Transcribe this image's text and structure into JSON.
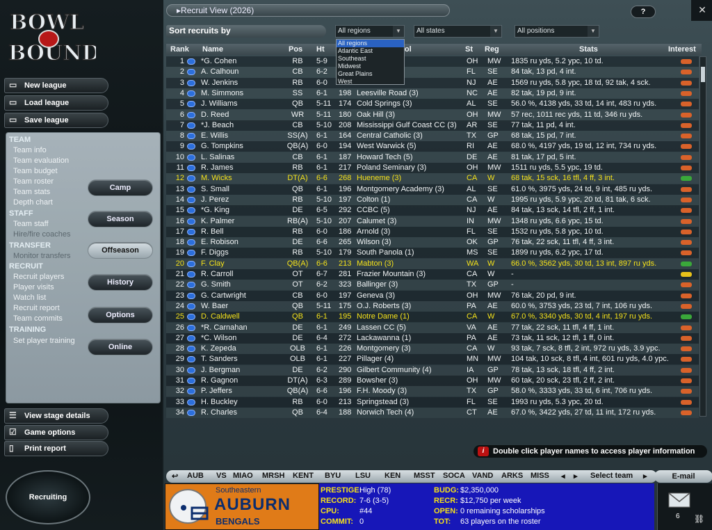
{
  "logo": {
    "line1": "BOWL",
    "line2": "BOUND"
  },
  "left": {
    "buttons": [
      {
        "label": "New league",
        "icon": "folder-icon"
      },
      {
        "label": "Load league",
        "icon": "folder-open-icon"
      },
      {
        "label": "Save league",
        "icon": "folder-save-icon"
      }
    ],
    "menu": {
      "team_h": "TEAM",
      "team": [
        "Team info",
        "Team evaluation",
        "Team budget",
        "Team roster",
        "Team stats",
        "Depth chart"
      ],
      "staff_h": "STAFF",
      "staff": [
        "Team staff",
        "Hire/fire coaches"
      ],
      "transfer_h": "TRANSFER",
      "transfer": [
        "Monitor transfers"
      ],
      "recruit_h": "RECRUIT",
      "recruit": [
        "Recruit players",
        "Player visits",
        "Watch list",
        "Recruit report",
        "Team commits"
      ],
      "training_h": "TRAINING",
      "training": [
        "Set player training"
      ]
    },
    "stages": [
      "Camp",
      "Season",
      "Offseason",
      "History",
      "Options",
      "Online"
    ],
    "bottom": [
      {
        "label": "View stage details",
        "icon": "list-icon"
      },
      {
        "label": "Game options",
        "icon": "checkbox-icon"
      },
      {
        "label": "Print report",
        "icon": "page-icon"
      }
    ],
    "recruiting": "Recruiting"
  },
  "main": {
    "title": "Recruit View (2026)",
    "help": "?",
    "sort_label": "Sort recruits by",
    "regions": {
      "value": "All regions",
      "options": [
        "All regions",
        "Atlantic East",
        "Southeast",
        "Midwest",
        "Great Plains",
        "West"
      ]
    },
    "states": "All states",
    "positions": "All positions",
    "headers": [
      "Rank",
      "Name",
      "Pos",
      "Ht",
      "Wt",
      "School",
      "St",
      "Reg",
      "Stats",
      "Interest"
    ],
    "info": "Double click player names to access player information",
    "email": "E-mail",
    "select_team": "Select team"
  },
  "players": [
    {
      "rank": "1",
      "name": "*G. Cohen",
      "pos": "RB",
      "ht": "5-9",
      "wt": "",
      "school": "ge (5)",
      "st": "OH",
      "reg": "MW",
      "stats": "1835 ru yds, 5.2 ypc, 10 td.",
      "interest": "#d9622a",
      "gold": false
    },
    {
      "rank": "2",
      "name": "A. Calhoun",
      "pos": "CB",
      "ht": "6-2",
      "wt": "",
      "school": "",
      "st": "FL",
      "reg": "SE",
      "stats": "84 tak, 13 pd, 4 int.",
      "interest": "#d9622a",
      "gold": false
    },
    {
      "rank": "3",
      "name": "W. Jenkins",
      "pos": "RB",
      "ht": "6-0",
      "wt": "",
      "school": "",
      "st": "NJ",
      "reg": "AE",
      "stats": "1569 ru yds, 5.8 ypc, 18 td, 92 tak, 4 sck.",
      "interest": "#d9622a",
      "gold": false
    },
    {
      "rank": "4",
      "name": "M. Simmons",
      "pos": "SS",
      "ht": "6-1",
      "wt": "198",
      "school": "Leesville Road (3)",
      "st": "NC",
      "reg": "AE",
      "stats": "82 tak, 19 pd, 9 int.",
      "interest": "#d9622a",
      "gold": false
    },
    {
      "rank": "5",
      "name": "J. Williams",
      "pos": "QB",
      "ht": "5-11",
      "wt": "174",
      "school": "Cold Springs (3)",
      "st": "AL",
      "reg": "SE",
      "stats": "56.0 %, 4138 yds, 33 td, 14 int, 483 ru yds.",
      "interest": "#d9622a",
      "gold": false
    },
    {
      "rank": "6",
      "name": "D. Reed",
      "pos": "WR",
      "ht": "5-11",
      "wt": "180",
      "school": "Oak Hill (3)",
      "st": "OH",
      "reg": "MW",
      "stats": "57 rec, 1011 rec yds, 11 td, 346 ru yds.",
      "interest": "#d9622a",
      "gold": false
    },
    {
      "rank": "7",
      "name": "*J. Beach",
      "pos": "CB",
      "ht": "5-10",
      "wt": "208",
      "school": "Mississippi Gulf Coast CC (3)",
      "st": "AR",
      "reg": "SE",
      "stats": "77 tak, 11 pd, 4 int.",
      "interest": "#d9622a",
      "gold": false
    },
    {
      "rank": "8",
      "name": "E. Willis",
      "pos": "SS(A)",
      "ht": "6-1",
      "wt": "164",
      "school": "Central Catholic (3)",
      "st": "TX",
      "reg": "GP",
      "stats": "68 tak, 15 pd, 7 int.",
      "interest": "#d9622a",
      "gold": false
    },
    {
      "rank": "9",
      "name": "G. Tompkins",
      "pos": "QB(A)",
      "ht": "6-0",
      "wt": "194",
      "school": "West Warwick (5)",
      "st": "RI",
      "reg": "AE",
      "stats": "68.0 %, 4197 yds, 19 td, 12 int, 734 ru yds.",
      "interest": "#d9622a",
      "gold": false
    },
    {
      "rank": "10",
      "name": "L. Salinas",
      "pos": "CB",
      "ht": "6-1",
      "wt": "187",
      "school": "Howard Tech (5)",
      "st": "DE",
      "reg": "AE",
      "stats": "81 tak, 17 pd, 5 int.",
      "interest": "#d9622a",
      "gold": false
    },
    {
      "rank": "11",
      "name": "R. James",
      "pos": "RB",
      "ht": "6-1",
      "wt": "217",
      "school": "Poland Seminary (3)",
      "st": "OH",
      "reg": "MW",
      "stats": "1511 ru yds, 5.5 ypc, 19 td.",
      "interest": "#d9622a",
      "gold": false
    },
    {
      "rank": "12",
      "name": "M. Wicks",
      "pos": "DT(A)",
      "ht": "6-6",
      "wt": "268",
      "school": "Hueneme (3)",
      "st": "CA",
      "reg": "W",
      "stats": "68 tak, 15 sck, 16 tfl, 4 ff, 3 int.",
      "interest": "#3aa83a",
      "gold": true
    },
    {
      "rank": "13",
      "name": "S. Small",
      "pos": "QB",
      "ht": "6-1",
      "wt": "196",
      "school": "Montgomery Academy (3)",
      "st": "AL",
      "reg": "SE",
      "stats": "61.0 %, 3975 yds, 24 td, 9 int, 485 ru yds.",
      "interest": "#d9622a",
      "gold": false
    },
    {
      "rank": "14",
      "name": "J. Perez",
      "pos": "RB",
      "ht": "5-10",
      "wt": "197",
      "school": "Colton (1)",
      "st": "CA",
      "reg": "W",
      "stats": "1995 ru yds, 5.9 ypc, 20 td, 81 tak, 6 sck.",
      "interest": "#d9622a",
      "gold": false
    },
    {
      "rank": "15",
      "name": "*G. King",
      "pos": "DE",
      "ht": "6-5",
      "wt": "292",
      "school": "CCBC (5)",
      "st": "NJ",
      "reg": "AE",
      "stats": "84 tak, 13 sck, 14 tfl, 2 ff, 1 int.",
      "interest": "#d9622a",
      "gold": false
    },
    {
      "rank": "16",
      "name": "K. Palmer",
      "pos": "RB(A)",
      "ht": "5-10",
      "wt": "207",
      "school": "Calumet (3)",
      "st": "IN",
      "reg": "MW",
      "stats": "1348 ru yds, 6.6 ypc, 15 td.",
      "interest": "#d9622a",
      "gold": false
    },
    {
      "rank": "17",
      "name": "R. Bell",
      "pos": "RB",
      "ht": "6-0",
      "wt": "186",
      "school": "Arnold (3)",
      "st": "FL",
      "reg": "SE",
      "stats": "1532 ru yds, 5.8 ypc, 10 td.",
      "interest": "#d9622a",
      "gold": false
    },
    {
      "rank": "18",
      "name": "E. Robison",
      "pos": "DE",
      "ht": "6-6",
      "wt": "265",
      "school": "Wilson (3)",
      "st": "OK",
      "reg": "GP",
      "stats": "76 tak, 22 sck, 11 tfl, 4 ff, 3 int.",
      "interest": "#d9622a",
      "gold": false
    },
    {
      "rank": "19",
      "name": "F. Diggs",
      "pos": "RB",
      "ht": "5-10",
      "wt": "179",
      "school": "South Panola (1)",
      "st": "MS",
      "reg": "SE",
      "stats": "1899 ru yds, 6.2 ypc, 17 td.",
      "interest": "#d9622a",
      "gold": false
    },
    {
      "rank": "20",
      "name": "F. Clay",
      "pos": "QB(A)",
      "ht": "6-6",
      "wt": "213",
      "school": "Mabton (3)",
      "st": "WA",
      "reg": "W",
      "stats": "66.0 %, 3562 yds, 30 td, 13 int, 897 ru yds.",
      "interest": "#3aa83a",
      "gold": true
    },
    {
      "rank": "21",
      "name": "R. Carroll",
      "pos": "OT",
      "ht": "6-7",
      "wt": "281",
      "school": "Frazier Mountain (3)",
      "st": "CA",
      "reg": "W",
      "stats": "-",
      "interest": "#e8c21a",
      "gold": false
    },
    {
      "rank": "22",
      "name": "G. Smith",
      "pos": "OT",
      "ht": "6-2",
      "wt": "323",
      "school": "Ballinger (3)",
      "st": "TX",
      "reg": "GP",
      "stats": "-",
      "interest": "#d9622a",
      "gold": false
    },
    {
      "rank": "23",
      "name": "G. Cartwright",
      "pos": "CB",
      "ht": "6-0",
      "wt": "197",
      "school": "Geneva (3)",
      "st": "OH",
      "reg": "MW",
      "stats": "76 tak, 20 pd, 9 int.",
      "interest": "#d9622a",
      "gold": false
    },
    {
      "rank": "24",
      "name": "W. Baer",
      "pos": "QB",
      "ht": "5-11",
      "wt": "175",
      "school": "O.J. Roberts (3)",
      "st": "PA",
      "reg": "AE",
      "stats": "60.0 %, 3753 yds, 23 td, 7 int, 106 ru yds.",
      "interest": "#d9622a",
      "gold": false
    },
    {
      "rank": "25",
      "name": "D. Caldwell",
      "pos": "QB",
      "ht": "6-1",
      "wt": "195",
      "school": "Notre Dame (1)",
      "st": "CA",
      "reg": "W",
      "stats": "67.0 %, 3340 yds, 30 td, 4 int, 197 ru yds.",
      "interest": "#3aa83a",
      "gold": true
    },
    {
      "rank": "26",
      "name": "*R. Carnahan",
      "pos": "DE",
      "ht": "6-1",
      "wt": "249",
      "school": "Lassen CC (5)",
      "st": "VA",
      "reg": "AE",
      "stats": "77 tak, 22 sck, 11 tfl, 4 ff, 1 int.",
      "interest": "#d9622a",
      "gold": false
    },
    {
      "rank": "27",
      "name": "*C. Wilson",
      "pos": "DE",
      "ht": "6-4",
      "wt": "272",
      "school": "Lackawanna (1)",
      "st": "PA",
      "reg": "AE",
      "stats": "73 tak, 11 sck, 12 tfl, 1 ff, 0 int.",
      "interest": "#d9622a",
      "gold": false
    },
    {
      "rank": "28",
      "name": "K. Zepeda",
      "pos": "OLB",
      "ht": "6-1",
      "wt": "226",
      "school": "Montgomery (3)",
      "st": "CA",
      "reg": "W",
      "stats": "93 tak, 7 sck, 8 tfl, 2 int, 972 ru yds, 3.9 ypc.",
      "interest": "#d9622a",
      "gold": false
    },
    {
      "rank": "29",
      "name": "T. Sanders",
      "pos": "OLB",
      "ht": "6-1",
      "wt": "227",
      "school": "Pillager (4)",
      "st": "MN",
      "reg": "MW",
      "stats": "104 tak, 10 sck, 8 tfl, 4 int, 601 ru yds, 4.0 ypc.",
      "interest": "#d9622a",
      "gold": false
    },
    {
      "rank": "30",
      "name": "J. Bergman",
      "pos": "DE",
      "ht": "6-2",
      "wt": "290",
      "school": "Gilbert Community (4)",
      "st": "IA",
      "reg": "GP",
      "stats": "78 tak, 13 sck, 18 tfl, 4 ff, 2 int.",
      "interest": "#d9622a",
      "gold": false
    },
    {
      "rank": "31",
      "name": "R. Gagnon",
      "pos": "DT(A)",
      "ht": "6-3",
      "wt": "289",
      "school": "Bowsher (3)",
      "st": "OH",
      "reg": "MW",
      "stats": "60 tak, 20 sck, 23 tfl, 2 ff, 2 int.",
      "interest": "#d9622a",
      "gold": false
    },
    {
      "rank": "32",
      "name": "P. Jeffers",
      "pos": "QB(A)",
      "ht": "6-6",
      "wt": "196",
      "school": "F.H. Moody (3)",
      "st": "TX",
      "reg": "GP",
      "stats": "58.0 %, 3333 yds, 33 td, 6 int, 706 ru yds.",
      "interest": "#d9622a",
      "gold": false
    },
    {
      "rank": "33",
      "name": "H. Buckley",
      "pos": "RB",
      "ht": "6-0",
      "wt": "213",
      "school": "Springstead (3)",
      "st": "FL",
      "reg": "SE",
      "stats": "1993 ru yds, 5.3 ypc, 20 td.",
      "interest": "#d9622a",
      "gold": false
    },
    {
      "rank": "34",
      "name": "R. Charles",
      "pos": "QB",
      "ht": "6-4",
      "wt": "188",
      "school": "Norwich Tech (4)",
      "st": "CT",
      "reg": "AE",
      "stats": "67.0 %, 3422 yds, 27 td, 11 int, 172 ru yds.",
      "interest": "#d9622a",
      "gold": false
    }
  ],
  "teams": [
    "AUB",
    "VS",
    "MIAO",
    "MRSH",
    "KENT",
    "BYU",
    "LSU",
    "KEN",
    "MSST",
    "SOCA",
    "VAND",
    "ARKS",
    "MISS"
  ],
  "team_card": {
    "conference": "Southeastern",
    "name": "AUBURN",
    "mascot": "BENGALS"
  },
  "team_stats": {
    "prestige_l": "PRESTIGE:",
    "prestige": "High (78)",
    "record_l": "RECORD:",
    "record": "7-6 (3-5)",
    "cpu_l": "CPU:",
    "cpu": "#44",
    "commit_l": "COMMIT:",
    "commit": "0",
    "budg_l": "BUDG:",
    "budg": "$2,350,000",
    "recr_l": "RECR:",
    "recr": "$12,750 per week",
    "open_l": "OPEN:",
    "open": "0 remaining scholarships",
    "tot_l": "TOT:",
    "tot": "63 players on the roster"
  },
  "mail_count": "6"
}
